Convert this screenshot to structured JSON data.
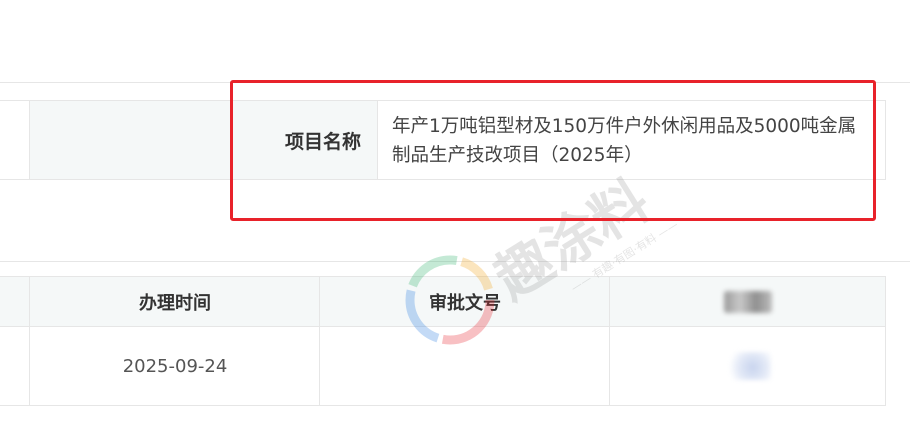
{
  "project": {
    "label": "项目名称",
    "value": "年产1万吨铝型材及150万件户外休闲用品及5000吨金属制品生产技改项目（2025年）"
  },
  "watermark": {
    "text": "趣涂料",
    "subtitle": "—— 有趣·有图·有料 ——",
    "accent_colors": [
      "#e8222a",
      "#2a7de1",
      "#2fb36b",
      "#f2a31b"
    ]
  },
  "approval_table": {
    "headers": [
      "办理时间",
      "审批文号",
      ""
    ],
    "rows": [
      {
        "time": "2025-09-24",
        "doc_number": "",
        "extra": ""
      }
    ]
  },
  "colors": {
    "highlight": "#e8222a",
    "header_bg": "#f5f8f8",
    "border": "#e6e6e6"
  }
}
